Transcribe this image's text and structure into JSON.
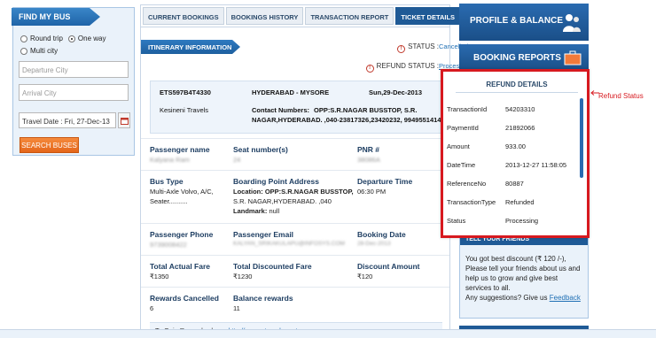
{
  "search": {
    "title": "FIND MY BUS",
    "trip_types": [
      "Round trip",
      "One way",
      "Multi city"
    ],
    "selected_trip": "One way",
    "departure_placeholder": "Departure City",
    "arrival_placeholder": "Arrival City",
    "travel_date": "Travel Date : Fri, 27-Dec-13",
    "search_label": "SEARCH BUSES"
  },
  "tabs": [
    {
      "label": "CURRENT BOOKINGS",
      "active": false
    },
    {
      "label": "BOOKINGS HISTORY",
      "active": false
    },
    {
      "label": "TRANSACTION REPORT",
      "active": false
    },
    {
      "label": "TICKET DETAILS",
      "active": true
    }
  ],
  "itinerary": {
    "title": "ITINERARY INFORMATION",
    "status_label": "STATUS :",
    "status_value": "Cancelled",
    "refund_status_label": "REFUND STATUS :",
    "refund_status_value": "Processing"
  },
  "journey": {
    "ticket_id": "ETS597B4T4330",
    "route": "HYDERABAD - MYSORE",
    "date": "Sun,29-Dec-2013",
    "operator": "Kesineni Travels",
    "contact_label": "Contact Numbers:",
    "contact_line1": "OPP:S.R.NAGAR BUSSTOP, S.R.",
    "contact_line2": "NAGAR,HYDERABAD. ,040-23817326,23420232, 9949551414"
  },
  "details": {
    "passenger_name_label": "Passenger name",
    "passenger_name_value": "Kalyana Ram",
    "seat_label": "Seat number(s)",
    "seat_value": "24",
    "pnr_label": "PNR #",
    "pnr_value": "38086A",
    "bus_type_label": "Bus Type",
    "bus_type_value_1": "Multi-Axle Volvo, A/C,",
    "bus_type_value_2": "Seater..........",
    "boarding_label": "Boarding Point Address",
    "boarding_location_label": "Location:",
    "boarding_location_1": "OPP:S.R.NAGAR BUSSTOP,",
    "boarding_location_2": "S.R. NAGAR,HYDERABAD. ,040",
    "landmark_label": "Landmark:",
    "landmark_value": "null",
    "departure_label": "Departure Time",
    "departure_value": "06:30 PM",
    "phone_label": "Passenger Phone",
    "phone_value": "9739008422",
    "email_label": "Passenger Email",
    "email_value": "KALYAN_SRIKAKULAPU@INFOSYS.COM",
    "booking_date_label": "Booking Date",
    "booking_date_value": "28-Dec-2013",
    "total_fare_label": "Total Actual Fare",
    "total_fare_value": "₹1350",
    "discounted_fare_label": "Total Discounted Fare",
    "discounted_fare_value": "₹1230",
    "discount_label": "Discount Amount",
    "discount_value": "₹120",
    "rewards_cancelled_label": "Rewards Cancelled",
    "rewards_cancelled_value": "6",
    "balance_rewards_label": "Balance rewards",
    "balance_rewards_value": "11",
    "rewards_share_text": "To Gain Rewards share:",
    "rewards_share_link": "http://www.etravelsmart.com"
  },
  "right_panel": {
    "profile_label": "PROFILE & BALANCE",
    "booking_reports_label": "BOOKING REPORTS",
    "tell_title": "TELL YOUR FRIENDS",
    "tell_text": "You got best discount (₹ 120 /-), Please tell your friends about us and help us to grow and give best services to all.",
    "suggestion_text": "Any suggestions? Give us",
    "feedback_link": "Feedback"
  },
  "refund_details": {
    "title": "REFUND DETAILS",
    "rows": [
      {
        "key": "TransactionId",
        "value": "54203310"
      },
      {
        "key": "PaymentId",
        "value": "21892066"
      },
      {
        "key": "Amount",
        "value": "933.00"
      },
      {
        "key": "DateTime",
        "value": "2013-12-27 11:58:05"
      },
      {
        "key": "ReferenceNo",
        "value": "80887"
      },
      {
        "key": "TransactionType",
        "value": "Refunded"
      },
      {
        "key": "Status",
        "value": "Processing"
      }
    ]
  },
  "annotation": {
    "label": "Refund Status",
    "color": "#d7191f"
  },
  "colors": {
    "primary_blue": "#1f5a96",
    "accent_orange": "#e5661a",
    "link_blue": "#1f6fb4"
  }
}
